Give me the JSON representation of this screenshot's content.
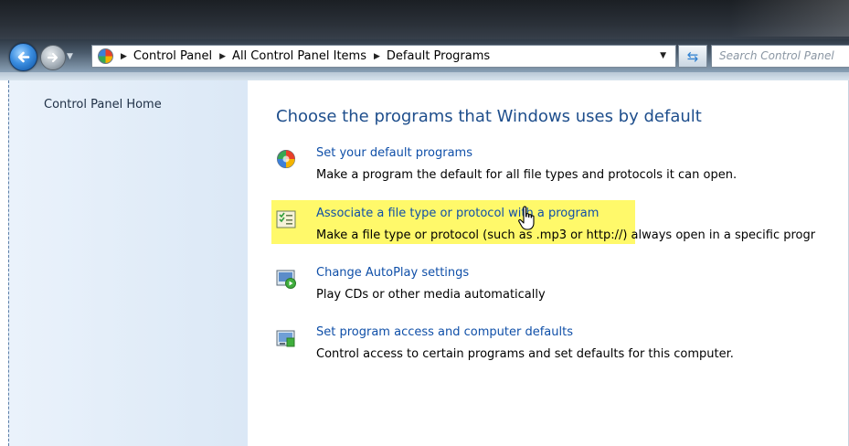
{
  "address_bar": {
    "breadcrumbs": [
      "Control Panel",
      "All Control Panel Items",
      "Default Programs"
    ],
    "search_placeholder": "Search Control Panel"
  },
  "left_pane": {
    "home_link": "Control Panel Home"
  },
  "main": {
    "heading": "Choose the programs that Windows uses by default",
    "tasks": [
      {
        "icon": "default-programs-icon",
        "link": "Set your default programs",
        "description": "Make a program the default for all file types and protocols it can open."
      },
      {
        "icon": "file-association-icon",
        "link": "Associate a file type or protocol with a program",
        "description": "Make a file type or protocol (such as .mp3 or http://) always open in a specific progr",
        "highlighted": true
      },
      {
        "icon": "autoplay-icon",
        "link": "Change AutoPlay settings",
        "description": "Play CDs or other media automatically"
      },
      {
        "icon": "program-access-icon",
        "link": "Set program access and computer defaults",
        "description": "Control access to certain programs and set defaults for this computer."
      }
    ]
  },
  "colors": {
    "heading": "#1e4e8c",
    "link": "#0f4fa8",
    "highlight": "#fff85a",
    "left_pane": "#dbe8f6"
  }
}
